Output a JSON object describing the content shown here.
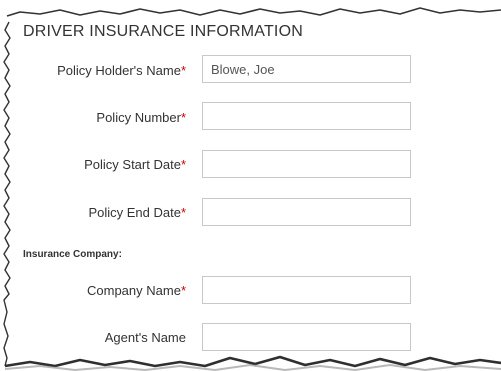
{
  "form": {
    "title": "DRIVER INSURANCE INFORMATION",
    "required_marker": "*",
    "fields": [
      {
        "label": "Policy Holder's Name",
        "required": true,
        "value": "Blowe, Joe"
      },
      {
        "label": "Policy Number",
        "required": true,
        "value": ""
      },
      {
        "label": "Policy Start Date",
        "required": true,
        "value": ""
      },
      {
        "label": "Policy End Date",
        "required": true,
        "value": ""
      }
    ],
    "group_heading": "Insurance Company:",
    "company_fields": [
      {
        "label": "Company Name",
        "required": true,
        "value": ""
      },
      {
        "label": "Agent's Name",
        "required": false,
        "value": ""
      }
    ]
  },
  "colors": {
    "text": "#333333",
    "required_marker": "#cc0000",
    "input_border": "#c8c8c8",
    "frame_shadow": "#8a8a8a"
  }
}
